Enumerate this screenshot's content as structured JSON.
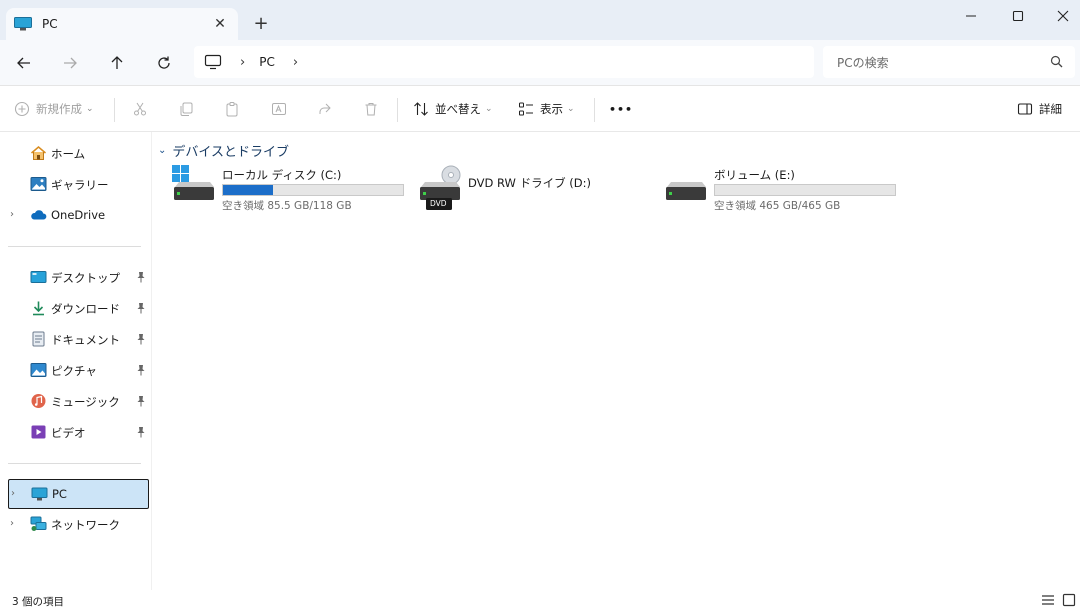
{
  "tab": {
    "title": "PC",
    "close_glyph": "✕",
    "new_glyph": "+"
  },
  "window": {
    "minimize_glyph": "—",
    "maximize_glyph": "▢",
    "close_glyph": "✕"
  },
  "address": {
    "separator": "›",
    "path": "PC",
    "trailing": "›"
  },
  "search": {
    "placeholder": "PCの検索"
  },
  "commands": {
    "new": "新規作成",
    "sort": "並べ替え",
    "view": "表示",
    "more": "•••",
    "details": "詳細"
  },
  "sidebar": {
    "top": [
      {
        "label": "ホーム"
      },
      {
        "label": "ギャラリー"
      },
      {
        "label": "OneDrive"
      }
    ],
    "pinned": [
      {
        "label": "デスクトップ"
      },
      {
        "label": "ダウンロード"
      },
      {
        "label": "ドキュメント"
      },
      {
        "label": "ピクチャ"
      },
      {
        "label": "ミュージック"
      },
      {
        "label": "ビデオ"
      }
    ],
    "bottom": [
      {
        "label": "PC"
      },
      {
        "label": "ネットワーク"
      }
    ],
    "expander_glyph": "›"
  },
  "content": {
    "group_title": "デバイスとドライブ",
    "drives": [
      {
        "name": "ローカル ディスク (C:)",
        "free": "空き領域 85.5 GB/118 GB",
        "used_fraction": 0.28
      },
      {
        "name": "DVD RW ドライブ (D:)",
        "badge": "DVD"
      },
      {
        "name": "ボリューム (E:)",
        "free": "空き領域 465 GB/465 GB",
        "used_fraction": 0.0
      }
    ]
  },
  "status": {
    "item_count": "3 個の項目"
  },
  "colors": {
    "accent": "#1c6ec9",
    "selected_bg": "#cce4f7",
    "title_bg": "#e8eef6"
  }
}
